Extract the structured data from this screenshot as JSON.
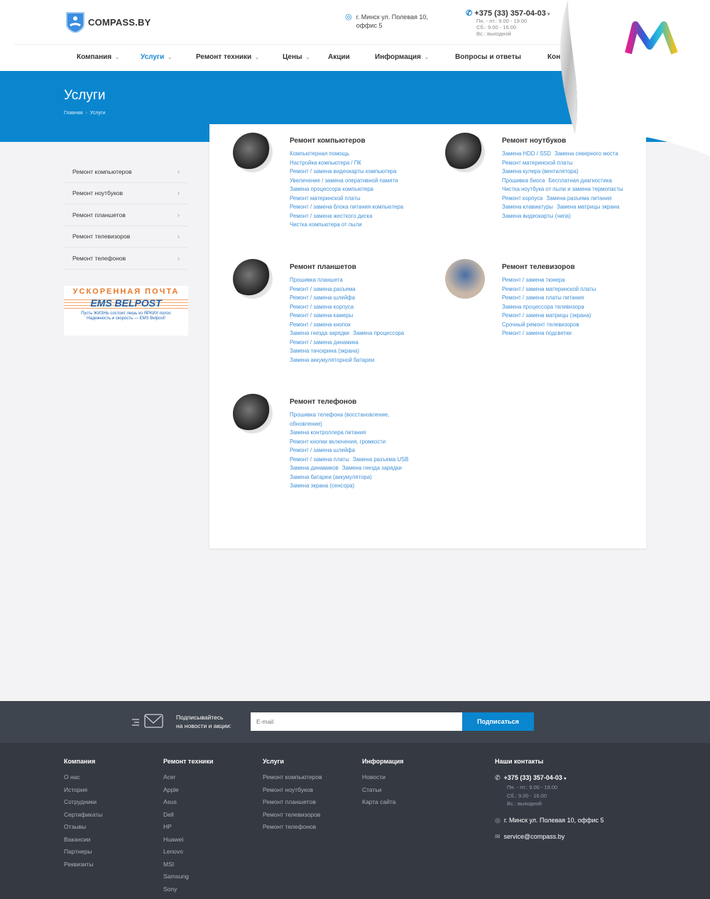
{
  "header": {
    "brand": "COMPASS.BY",
    "address": [
      "г. Минск ул. Полевая 10,",
      "оффис 5"
    ],
    "phone": "+375 (33) 357-04-03",
    "hours": [
      "Пн. - пт.: 9.00 - 19.00",
      "Сб.: 9.00 - 16.00",
      "Вс.: выходной"
    ]
  },
  "nav": [
    {
      "label": "Компания",
      "dropdown": true
    },
    {
      "label": "Услуги",
      "dropdown": true,
      "active": true
    },
    {
      "label": "Ремонт техники",
      "dropdown": true
    },
    {
      "label": "Цены",
      "dropdown": true
    },
    {
      "label": "Акции"
    },
    {
      "label": "Информация",
      "dropdown": true
    },
    {
      "label": "Вопросы и ответы"
    },
    {
      "label": "Контак"
    }
  ],
  "hero": {
    "title": "Услуги",
    "breadcrumb": [
      "Главная",
      "Услуги"
    ]
  },
  "sidebar": [
    "Ремонт компьютеров",
    "Ремонт ноутбуков",
    "Ремонт планшетов",
    "Ремонт телевизоров",
    "Ремонт телефонов"
  ],
  "banner": {
    "title": "УСКОРЕННАЯ ПОЧТА",
    "logo": "EMS BELPOST",
    "line1": "Пусть ЖИЗНЬ состоит лишь из ЯРКИХ полос",
    "line2": "Надежность и скорость — EMS Belpost!"
  },
  "sections": [
    {
      "title": "Ремонт компьютеров",
      "links": [
        "Компьютерная помощь",
        "Настройка компьютера / ПК",
        "Ремонт / замена видеокарты компьютера",
        "Увеличение / замена оперативной памяти",
        "Замена процессора компьютера",
        "Ремонт материнской платы",
        "Ремонт / замена блока питания компьютера",
        "Ремонт / замена жесткого диска",
        "Чистка компьютера от пыли"
      ]
    },
    {
      "title": "Ремонт ноутбуков",
      "links": [
        "Замена HDD / SSD",
        "Замена северного моста",
        "Ремонт материнской платы",
        "Замена кулера (вентилятора)",
        "Прошивка биоса",
        "Бесплатная диагностика",
        "Чистка ноутбука от пыли и замена термопасты",
        "Ремонт корпуса",
        "Замена разъема питания",
        "Замена клавиатуры",
        "Замена матрицы экрана",
        "Замена видеокарты (чипа)"
      ]
    },
    {
      "title": "Ремонт планшетов",
      "links": [
        "Прошивка планшета",
        "Ремонт / замена разъема",
        "Ремонт / замена шлейфа",
        "Ремонт / замена корпуса",
        "Ремонт / замена камеры",
        "Ремонт / замена кнопок",
        "Замена гнезда зарядки",
        "Замена процессора",
        "Ремонт / замена динамика",
        "Замена тачскрина (экрана)",
        "Замена аккумуляторной батареи"
      ]
    },
    {
      "title": "Ремонт телевизоров",
      "links": [
        "Ремонт / замена тюнера",
        "Ремонт / замена материнской платы",
        "Ремонт / замена платы питания",
        "Замена процессора телевизора",
        "Ремонт / замена матрицы (экрана)",
        "Срочный ремонт телевизоров",
        "Ремонт / замена подсветки"
      ]
    },
    {
      "title": "Ремонт телефонов",
      "links": [
        "Прошивка телефона (восстановление, обновление)",
        "Замена контроллера питания",
        "Ремонт кнопки включения, громкости",
        "Ремонт / замена шлейфа",
        "Ремонт / замена платы",
        "Замена разъема USB",
        "Замена динамиков",
        "Замена гнезда зарядки",
        "Замена батареи (аккумулятора)",
        "Замена экрана (сенсора)"
      ]
    }
  ],
  "subscribe": {
    "text": [
      "Подписывайтесь",
      "на новости и акции:"
    ],
    "placeholder": "E-mail",
    "button": "Подписаться"
  },
  "footer": {
    "columns": [
      {
        "title": "Компания",
        "links": [
          "О нас",
          "История",
          "Сотрудники",
          "Сертификаты",
          "Отзывы",
          "Вакансии",
          "Партнеры",
          "Реквизиты"
        ]
      },
      {
        "title": "Ремонт техники",
        "links": [
          "Acer",
          "Apple",
          "Asus",
          "Dell",
          "HP",
          "Huawei",
          "Lenovo",
          "MSI",
          "Samsung",
          "Sony"
        ]
      },
      {
        "title": "Услуги",
        "links": [
          "Ремонт компьютеров",
          "Ремонт ноутбуков",
          "Ремонт планшетов",
          "Ремонт телевизоров",
          "Ремонт телефонов"
        ]
      },
      {
        "title": "Информация",
        "links": [
          "Новости",
          "Статьи",
          "Карта сайта"
        ]
      }
    ],
    "contacts": {
      "title": "Наши контакты",
      "phone": "+375 (33) 357-04-03",
      "hours": [
        "Пн. - пт.: 9.00 - 19.00",
        "Сб.: 9.00 - 16.00",
        "Вс.: выходной"
      ],
      "address": "г. Минск ул. Полевая 10, оффис 5",
      "email": "service@compass.by"
    }
  },
  "colors": {
    "accent": "#0a86cf",
    "link": "#3f8fd6",
    "footer": "#353a42"
  }
}
